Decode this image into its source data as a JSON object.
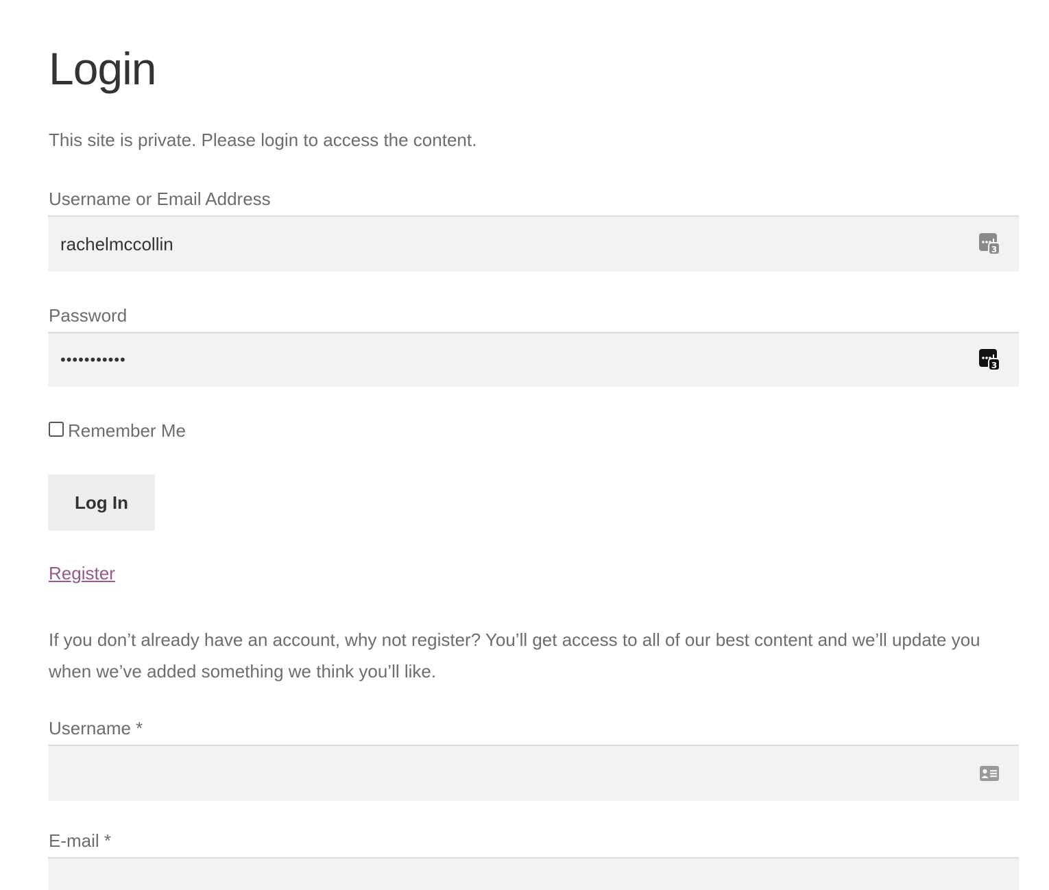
{
  "page": {
    "title": "Login",
    "intro": "This site is private. Please login to access the content."
  },
  "login_form": {
    "username_label": "Username or Email Address",
    "username_value": "rachelmccollin",
    "username_icon": "password-manager-icon",
    "password_label": "Password",
    "password_value": "•••••••••••",
    "password_icon": "password-manager-icon",
    "password_manager_badge": "3",
    "remember_label": "Remember Me",
    "remember_checked": false,
    "submit_label": "Log In"
  },
  "register": {
    "link_label": "Register",
    "description": "If you don’t already have an account, why not register? You’ll get access to all of our best content and we’ll update you when we’ve added something we think you’ll like.",
    "username_label": "Username *",
    "username_value": "",
    "username_icon": "contact-card-icon",
    "email_label": "E-mail *",
    "email_value": ""
  },
  "colors": {
    "link": "#96588a",
    "field_bg": "#f2f2f2",
    "button_bg": "#eeeeee",
    "text": "#6d6d6d",
    "heading": "#333333"
  }
}
